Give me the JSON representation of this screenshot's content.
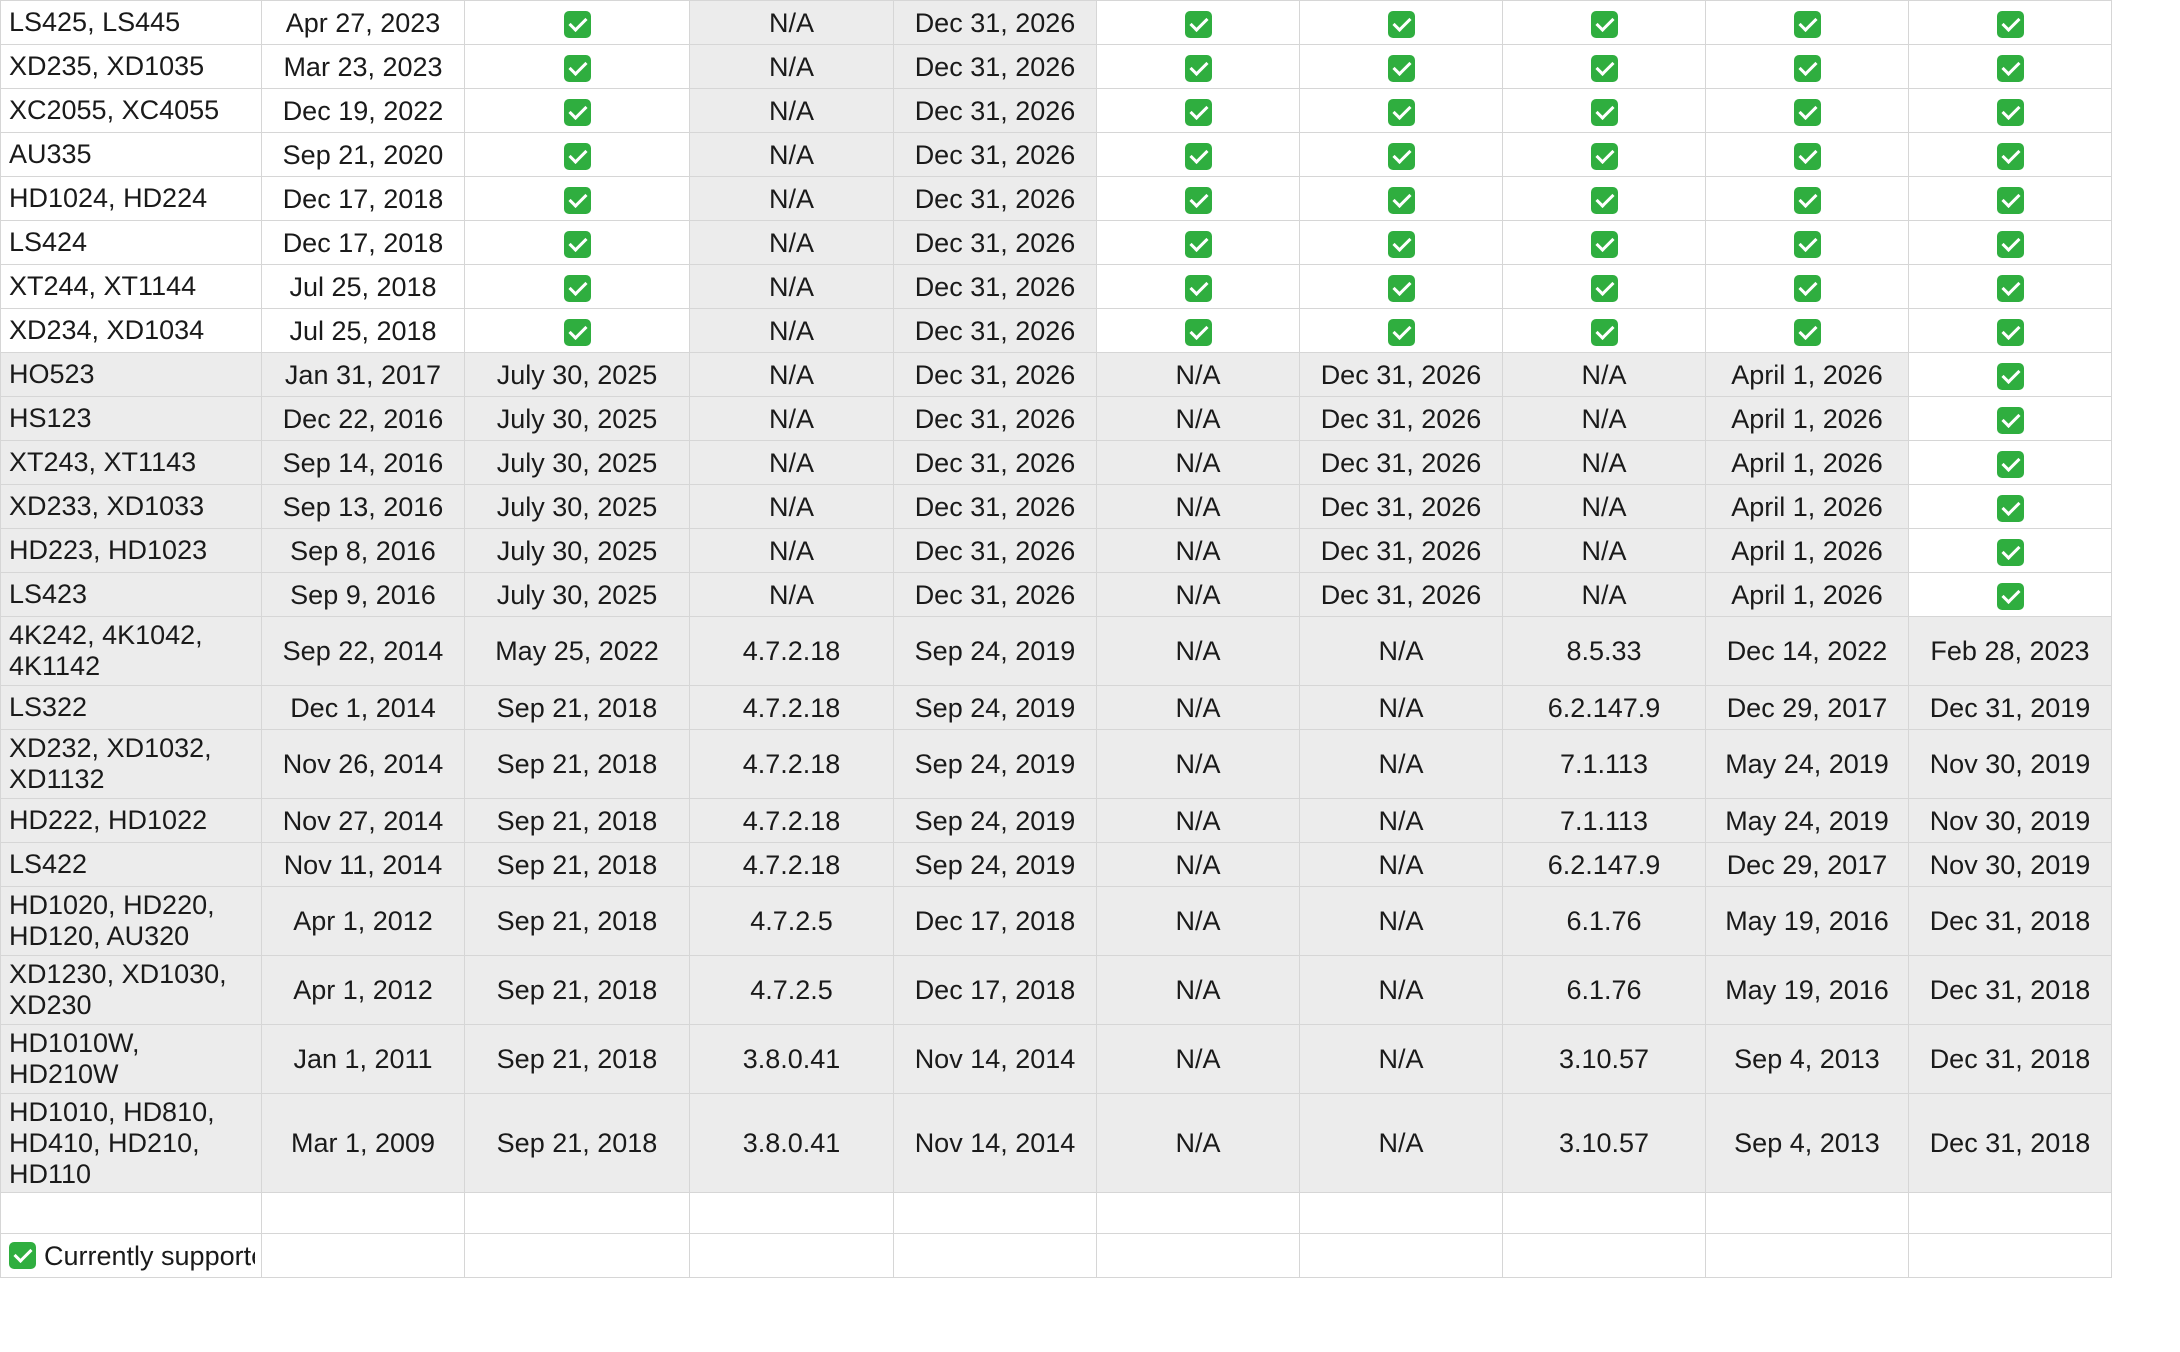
{
  "check_icon": "white-check-mark-icon",
  "colors": {
    "check_bg": "#2fae3f",
    "gray_cell": "#ececec",
    "grid_line": "#d6d6d6"
  },
  "rows": [
    {
      "model": "LS425, LS445",
      "c": [
        "Apr 27, 2023",
        "check",
        "N/A",
        "Dec 31, 2026",
        "check",
        "check",
        "check",
        "check",
        "check"
      ],
      "g": [
        0,
        0,
        0,
        1,
        1,
        0,
        0,
        0,
        0,
        0
      ]
    },
    {
      "model": "XD235, XD1035",
      "c": [
        "Mar 23, 2023",
        "check",
        "N/A",
        "Dec 31, 2026",
        "check",
        "check",
        "check",
        "check",
        "check"
      ],
      "g": [
        0,
        0,
        0,
        1,
        1,
        0,
        0,
        0,
        0,
        0
      ]
    },
    {
      "model": "XC2055, XC4055",
      "c": [
        "Dec 19, 2022",
        "check",
        "N/A",
        "Dec 31, 2026",
        "check",
        "check",
        "check",
        "check",
        "check"
      ],
      "g": [
        0,
        0,
        0,
        1,
        1,
        0,
        0,
        0,
        0,
        0
      ]
    },
    {
      "model": "AU335",
      "c": [
        "Sep 21, 2020",
        "check",
        "N/A",
        "Dec 31, 2026",
        "check",
        "check",
        "check",
        "check",
        "check"
      ],
      "g": [
        0,
        0,
        0,
        1,
        1,
        0,
        0,
        0,
        0,
        0
      ]
    },
    {
      "model": "HD1024, HD224",
      "c": [
        "Dec 17, 2018",
        "check",
        "N/A",
        "Dec 31, 2026",
        "check",
        "check",
        "check",
        "check",
        "check"
      ],
      "g": [
        0,
        0,
        0,
        1,
        1,
        0,
        0,
        0,
        0,
        0
      ]
    },
    {
      "model": "LS424",
      "c": [
        "Dec 17, 2018",
        "check",
        "N/A",
        "Dec 31, 2026",
        "check",
        "check",
        "check",
        "check",
        "check"
      ],
      "g": [
        0,
        0,
        0,
        1,
        1,
        0,
        0,
        0,
        0,
        0
      ]
    },
    {
      "model": "XT244, XT1144",
      "c": [
        "Jul 25, 2018",
        "check",
        "N/A",
        "Dec 31, 2026",
        "check",
        "check",
        "check",
        "check",
        "check"
      ],
      "g": [
        0,
        0,
        0,
        1,
        1,
        0,
        0,
        0,
        0,
        0
      ]
    },
    {
      "model": "XD234, XD1034",
      "c": [
        "Jul 25, 2018",
        "check",
        "N/A",
        "Dec 31, 2026",
        "check",
        "check",
        "check",
        "check",
        "check"
      ],
      "g": [
        0,
        0,
        0,
        1,
        1,
        0,
        0,
        0,
        0,
        0
      ]
    },
    {
      "model": "HO523",
      "c": [
        "Jan 31, 2017",
        "July 30, 2025",
        "N/A",
        "Dec 31, 2026",
        "N/A",
        "Dec 31, 2026",
        "N/A",
        "April 1, 2026",
        "check"
      ],
      "g": [
        1,
        1,
        1,
        1,
        1,
        1,
        1,
        1,
        1,
        0
      ]
    },
    {
      "model": "HS123",
      "c": [
        "Dec 22, 2016",
        "July 30, 2025",
        "N/A",
        "Dec 31, 2026",
        "N/A",
        "Dec 31, 2026",
        "N/A",
        "April 1, 2026",
        "check"
      ],
      "g": [
        1,
        1,
        1,
        1,
        1,
        1,
        1,
        1,
        1,
        0
      ]
    },
    {
      "model": "XT243, XT1143",
      "c": [
        "Sep 14, 2016",
        "July 30, 2025",
        "N/A",
        "Dec 31, 2026",
        "N/A",
        "Dec 31, 2026",
        "N/A",
        "April 1, 2026",
        "check"
      ],
      "g": [
        1,
        1,
        1,
        1,
        1,
        1,
        1,
        1,
        1,
        0
      ]
    },
    {
      "model": "XD233, XD1033",
      "c": [
        "Sep 13, 2016",
        "July 30, 2025",
        "N/A",
        "Dec 31, 2026",
        "N/A",
        "Dec 31, 2026",
        "N/A",
        "April 1, 2026",
        "check"
      ],
      "g": [
        1,
        1,
        1,
        1,
        1,
        1,
        1,
        1,
        1,
        0
      ]
    },
    {
      "model": "HD223, HD1023",
      "c": [
        "Sep 8, 2016",
        "July 30, 2025",
        "N/A",
        "Dec 31, 2026",
        "N/A",
        "Dec 31, 2026",
        "N/A",
        "April 1, 2026",
        "check"
      ],
      "g": [
        1,
        1,
        1,
        1,
        1,
        1,
        1,
        1,
        1,
        0
      ]
    },
    {
      "model": "LS423",
      "c": [
        "Sep 9, 2016",
        "July 30, 2025",
        "N/A",
        "Dec 31, 2026",
        "N/A",
        "Dec 31, 2026",
        "N/A",
        "April 1, 2026",
        "check"
      ],
      "g": [
        1,
        1,
        1,
        1,
        1,
        1,
        1,
        1,
        1,
        0
      ]
    },
    {
      "model": "4K242, 4K1042, 4K1142",
      "tall": 1,
      "c": [
        "Sep 22, 2014",
        "May 25, 2022",
        "4.7.2.18",
        "Sep 24, 2019",
        "N/A",
        "N/A",
        "8.5.33",
        "Dec 14, 2022",
        "Feb 28, 2023"
      ],
      "g": [
        1,
        1,
        1,
        1,
        1,
        1,
        1,
        1,
        1,
        1
      ]
    },
    {
      "model": "LS322",
      "c": [
        "Dec 1, 2014",
        "Sep 21, 2018",
        "4.7.2.18",
        "Sep 24, 2019",
        "N/A",
        "N/A",
        "6.2.147.9",
        "Dec 29, 2017",
        "Dec 31, 2019"
      ],
      "g": [
        1,
        1,
        1,
        1,
        1,
        1,
        1,
        1,
        1,
        1
      ]
    },
    {
      "model": "XD232, XD1032, XD1132",
      "tall": 1,
      "c": [
        "Nov 26, 2014",
        "Sep 21, 2018",
        "4.7.2.18",
        "Sep 24, 2019",
        "N/A",
        "N/A",
        "7.1.113",
        "May 24, 2019",
        "Nov 30, 2019"
      ],
      "g": [
        1,
        1,
        1,
        1,
        1,
        1,
        1,
        1,
        1,
        1
      ]
    },
    {
      "model": "HD222, HD1022",
      "c": [
        "Nov 27, 2014",
        "Sep 21, 2018",
        "4.7.2.18",
        "Sep 24, 2019",
        "N/A",
        "N/A",
        "7.1.113",
        "May 24, 2019",
        "Nov 30, 2019"
      ],
      "g": [
        1,
        1,
        1,
        1,
        1,
        1,
        1,
        1,
        1,
        1
      ]
    },
    {
      "model": "LS422",
      "c": [
        "Nov 11, 2014",
        "Sep 21, 2018",
        "4.7.2.18",
        "Sep 24, 2019",
        "N/A",
        "N/A",
        "6.2.147.9",
        "Dec 29, 2017",
        "Nov 30, 2019"
      ],
      "g": [
        1,
        1,
        1,
        1,
        1,
        1,
        1,
        1,
        1,
        1
      ]
    },
    {
      "model": "HD1020, HD220, HD120, AU320",
      "tall": 1,
      "c": [
        "Apr 1, 2012",
        "Sep 21, 2018",
        "4.7.2.5",
        "Dec 17, 2018",
        "N/A",
        "N/A",
        "6.1.76",
        "May 19, 2016",
        "Dec 31, 2018"
      ],
      "g": [
        1,
        1,
        1,
        1,
        1,
        1,
        1,
        1,
        1,
        1
      ]
    },
    {
      "model": "XD1230, XD1030, XD230",
      "tall": 1,
      "c": [
        "Apr 1, 2012",
        "Sep 21, 2018",
        "4.7.2.5",
        "Dec 17, 2018",
        "N/A",
        "N/A",
        "6.1.76",
        "May 19, 2016",
        "Dec 31, 2018"
      ],
      "g": [
        1,
        1,
        1,
        1,
        1,
        1,
        1,
        1,
        1,
        1
      ]
    },
    {
      "model": "HD1010W, HD210W",
      "tall": 1,
      "c": [
        "Jan 1, 2011",
        "Sep 21, 2018",
        "3.8.0.41",
        "Nov 14, 2014",
        "N/A",
        "N/A",
        "3.10.57",
        "Sep 4, 2013",
        "Dec 31, 2018"
      ],
      "g": [
        1,
        1,
        1,
        1,
        1,
        1,
        1,
        1,
        1,
        1
      ]
    },
    {
      "model": "HD1010, HD810, HD410, HD210, HD110",
      "tall": 2,
      "c": [
        "Mar 1, 2009",
        "Sep 21, 2018",
        "3.8.0.41",
        "Nov 14, 2014",
        "N/A",
        "N/A",
        "3.10.57",
        "Sep 4, 2013",
        "Dec 31, 2018"
      ],
      "g": [
        1,
        1,
        1,
        1,
        1,
        1,
        1,
        1,
        1,
        1
      ]
    }
  ],
  "legend": {
    "label": "Currently supported"
  }
}
